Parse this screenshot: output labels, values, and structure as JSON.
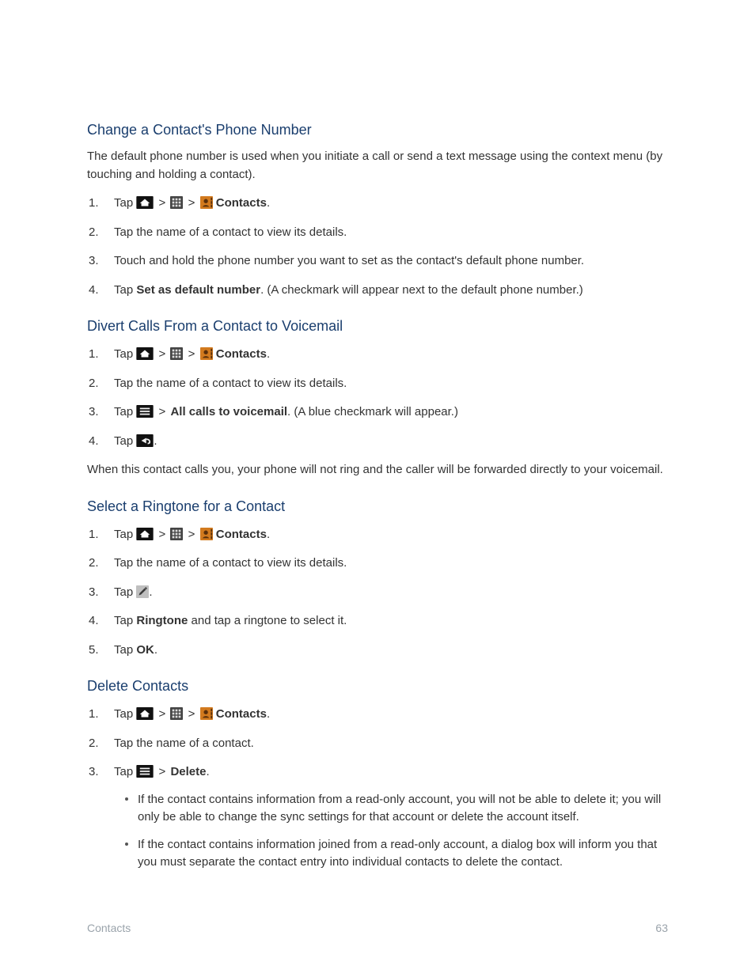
{
  "footer": {
    "section": "Contacts",
    "page_number": "63"
  },
  "sep": ">",
  "section1": {
    "heading": "Change a Contact's Phone Number",
    "intro": "The default phone number is used when you initiate a call or send a text message using the context menu (by touching and holding a contact).",
    "steps": {
      "s1_tap": "Tap ",
      "s1_contacts": "Contacts",
      "s1_period": ".",
      "s2": "Tap the name of a contact to view its details.",
      "s3": "Touch and hold the phone number you want to set as the contact's default phone number.",
      "s4_tap": "Tap ",
      "s4_bold": "Set as default number",
      "s4_after": ". (A checkmark will appear next to the default phone number.)"
    }
  },
  "section2": {
    "heading": "Divert Calls From a Contact to Voicemail",
    "steps": {
      "s1_tap": "Tap ",
      "s1_contacts": "Contacts",
      "s1_period": ".",
      "s2": "Tap the name of a contact to view its details.",
      "s3_tap": "Tap ",
      "s3_bold": "All calls to voicemail",
      "s3_after": ". (A blue checkmark will appear.)",
      "s4_tap": "Tap ",
      "s4_period": "."
    },
    "outro": "When this contact calls you, your phone will not ring and the caller will be forwarded directly to your voicemail."
  },
  "section3": {
    "heading": "Select a Ringtone for a Contact",
    "steps": {
      "s1_tap": "Tap ",
      "s1_contacts": "Contacts",
      "s1_period": ".",
      "s2": "Tap the name of a contact to view its details.",
      "s3_tap": "Tap ",
      "s3_period": ".",
      "s4_tap": "Tap ",
      "s4_bold": "Ringtone",
      "s4_after": " and tap a ringtone to select it.",
      "s5_tap": "Tap ",
      "s5_bold": "OK",
      "s5_period": "."
    }
  },
  "section4": {
    "heading": "Delete Contacts",
    "steps": {
      "s1_tap": "Tap ",
      "s1_contacts": "Contacts",
      "s1_period": ".",
      "s2": "Tap the name of a contact.",
      "s3_tap": "Tap ",
      "s3_bold": "Delete",
      "s3_period": ".",
      "b1": "If the contact contains information from a read-only account, you will not be able to delete it; you will only be able to change the sync settings for that account or delete the account itself.",
      "b2": "If the contact contains information joined from a read-only account, a dialog box will inform you that you must separate the contact entry into individual contacts to delete the contact."
    }
  }
}
